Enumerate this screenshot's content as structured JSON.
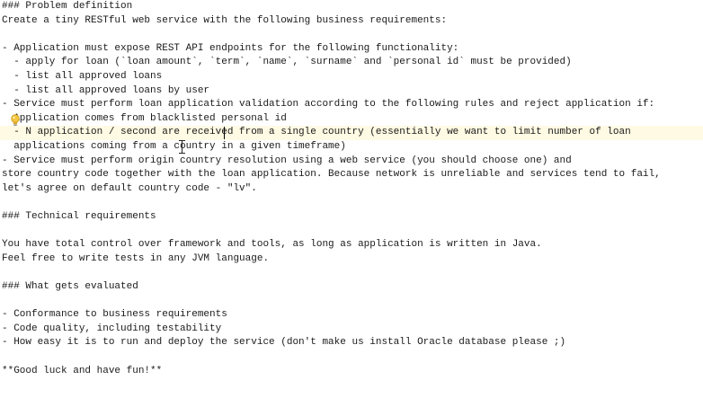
{
  "editor": {
    "lines": [
      "### Problem definition",
      "Create a tiny RESTful web service with the following business requirements:",
      "",
      "- Application must expose REST API endpoints for the following functionality:",
      "  - apply for loan (`loan amount`, `term`, `name`, `surname` and `personal id` must be provided)",
      "  - list all approved loans",
      "  - list all approved loans by user",
      "- Service must perform loan application validation according to the following rules and reject application if:",
      "  Application comes from blacklisted personal id",
      "  - N application / second are received from a single country (essentially we want to limit number of loan",
      "  applications coming from a country in a given timeframe)",
      "- Service must perform origin country resolution using a web service (you should choose one) and",
      "store country code together with the loan application. Because network is unreliable and services tend to fail,",
      "let's agree on default country code - \"lv\".",
      "",
      "### Technical requirements",
      "",
      "You have total control over framework and tools, as long as application is written in Java.",
      "Feel free to write tests in any JVM language.",
      "",
      "### What gets evaluated",
      "",
      "- Conformance to business requirements",
      "- Code quality, including testability",
      "- How easy it is to run and deploy the service (don't make us install Oracle database please ;)",
      "",
      "**Good luck and have fun!**"
    ],
    "current_line_color": "#fffae3",
    "intention_icon": "lightbulb-icon"
  }
}
